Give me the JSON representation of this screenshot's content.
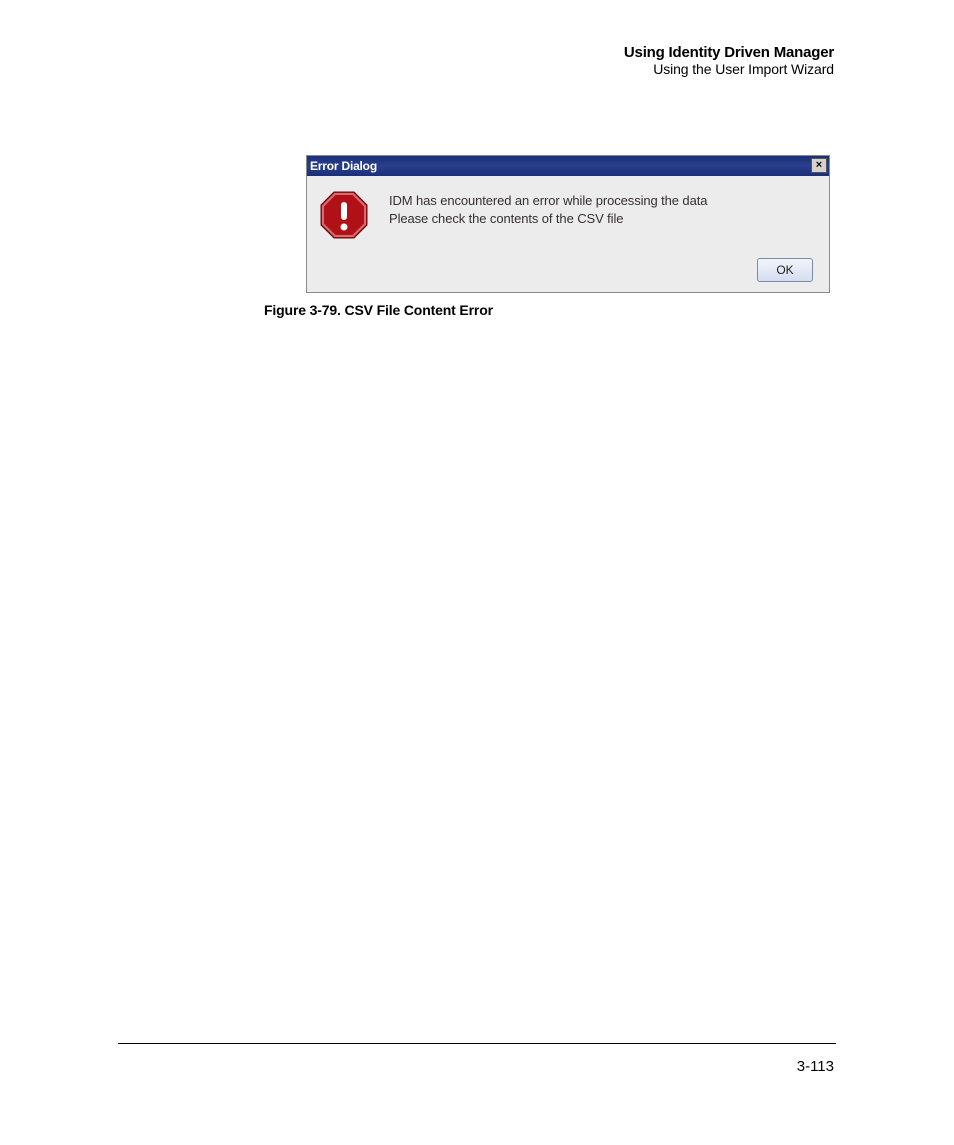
{
  "header": {
    "title": "Using Identity Driven Manager",
    "subtitle": "Using the User Import Wizard"
  },
  "dialog": {
    "title": "Error Dialog",
    "close_symbol": "×",
    "message_line1": "IDM has encountered an error while processing the data",
    "message_line2": "Please check the contents of the CSV file",
    "ok_label": "OK"
  },
  "caption": "Figure 3-79. CSV File Content Error",
  "page_number": "3-113",
  "colors": {
    "titlebar": "#1a2f7a",
    "error_red": "#b11116",
    "button_border": "#7a8aa8"
  }
}
